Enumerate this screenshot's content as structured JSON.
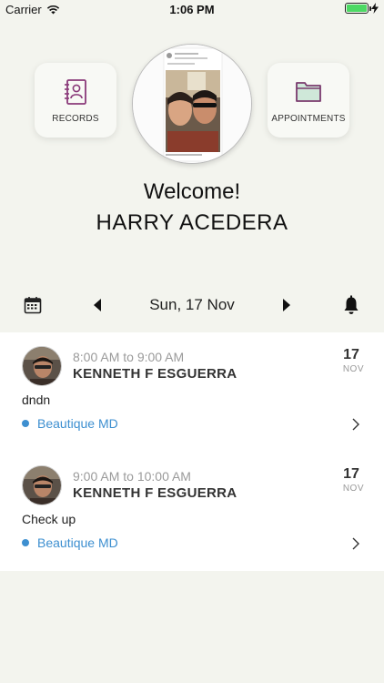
{
  "status_bar": {
    "carrier": "Carrier",
    "time": "1:06 PM"
  },
  "header": {
    "records_label": "RECORDS",
    "appointments_label": "APPOINTMENTS",
    "welcome": "Welcome!",
    "user_name": "HARRY  ACEDERA"
  },
  "date_bar": {
    "date": "Sun, 17 Nov"
  },
  "appointments": [
    {
      "time": "8:00 AM to 9:00 AM",
      "doctor": "KENNETH F  ESGUERRA",
      "day": "17",
      "month": "NOV",
      "note": "dndn",
      "clinic": "Beautique MD"
    },
    {
      "time": "9:00 AM to 10:00 AM",
      "doctor": "KENNETH F  ESGUERRA",
      "day": "17",
      "month": "NOV",
      "note": "Check up",
      "clinic": "Beautique MD"
    }
  ],
  "colors": {
    "background": "#f3f4ee",
    "clinic_accent": "#3d8fd0",
    "records_icon": "#8a3a7a",
    "appointments_icon": "#7a3a6e",
    "battery": "#4cd964"
  }
}
